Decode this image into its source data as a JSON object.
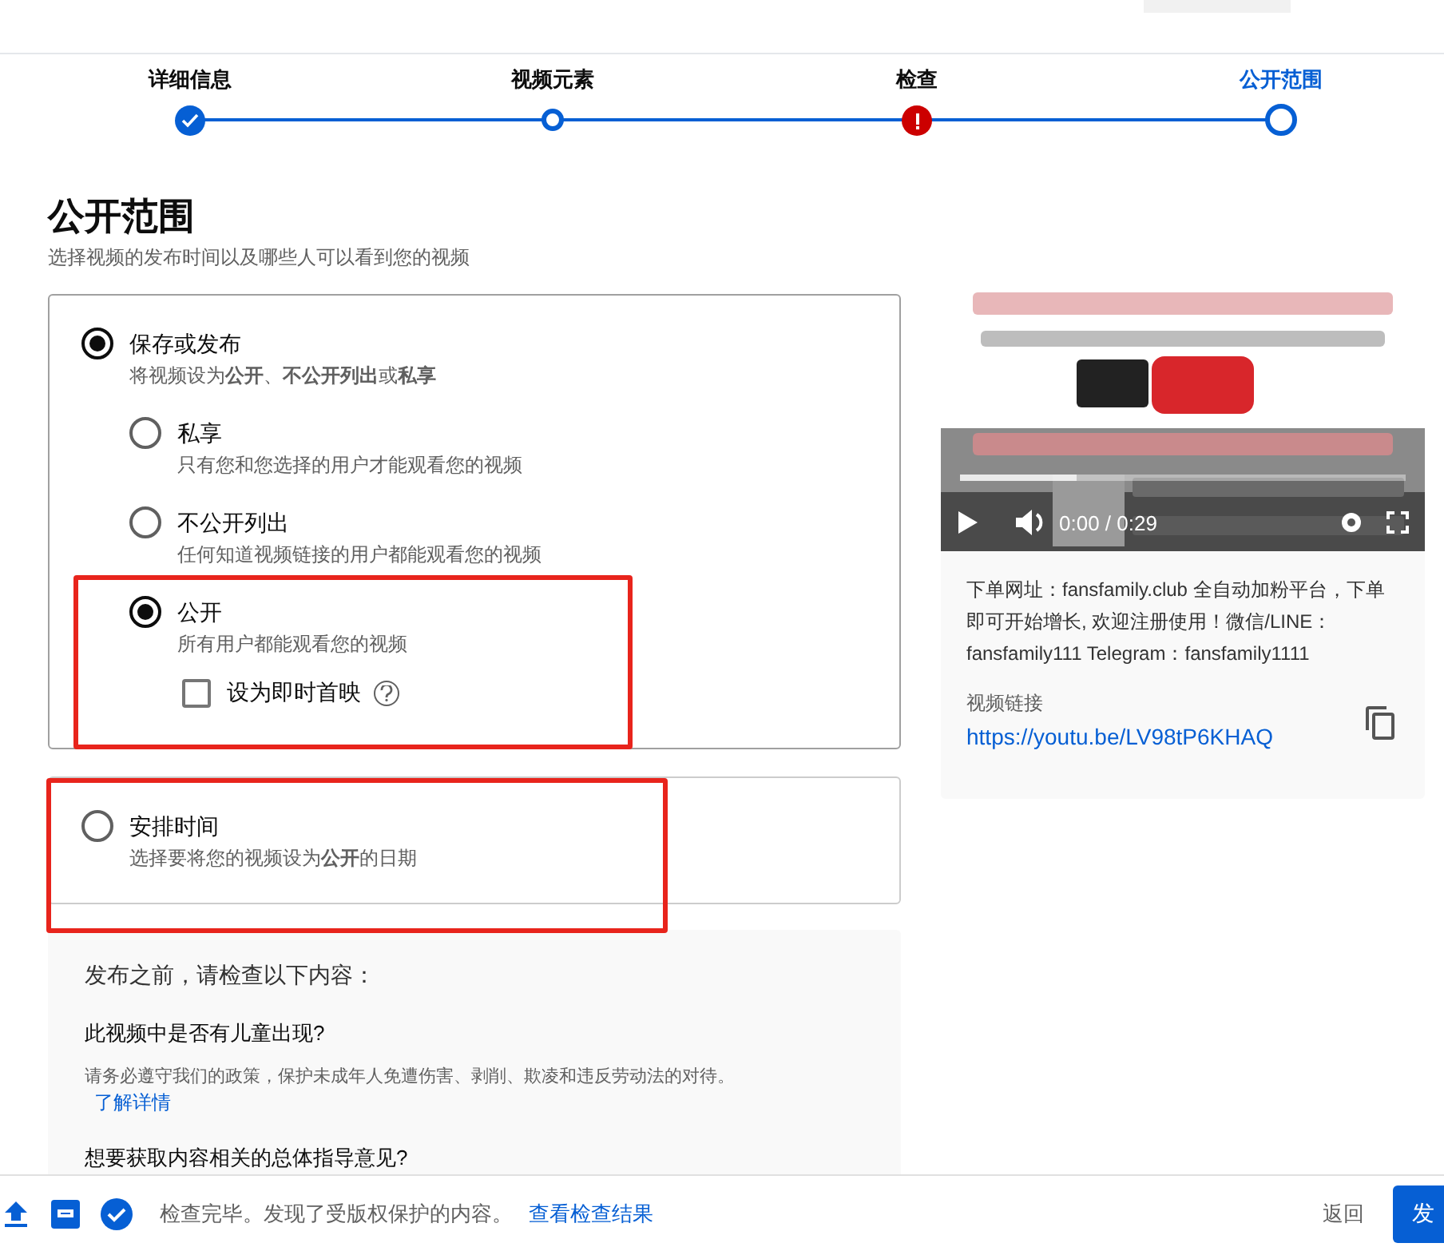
{
  "steps": [
    {
      "label": "详细信息",
      "kind": "done",
      "selected": false
    },
    {
      "label": "视频元素",
      "kind": "todo",
      "selected": false
    },
    {
      "label": "检查",
      "kind": "error",
      "selected": false
    },
    {
      "label": "公开范围",
      "kind": "todo",
      "selected": true
    }
  ],
  "heading": "公开范围",
  "subheading": "选择视频的发布时间以及哪些人可以看到您的视频",
  "save_option": {
    "label": "保存或发布",
    "description": "将视频设为**公开**、**不公开列出**或**私享**",
    "selected": true,
    "options": [
      {
        "label": "私享",
        "description": "只有您和您选择的用户才能观看您的视频",
        "selected": false
      },
      {
        "label": "不公开列出",
        "description": "任何知道视频链接的用户都能观看您的视频",
        "selected": false
      },
      {
        "label": "公开",
        "description": "所有用户都能观看您的视频",
        "selected": true
      }
    ],
    "premiere": {
      "label": "设为即时首映",
      "checked": false
    }
  },
  "schedule_option": {
    "label": "安排时间",
    "description": "选择要将您的视频设为**公开**的日期",
    "selected": false
  },
  "checklist": {
    "title": "发布之前，请检查以下内容：",
    "items": [
      {
        "question": "此视频中是否有儿童出现?",
        "text": "请务必遵守我们的政策，保护未成年人免遭伤害、剥削、欺凌和违反劳动法的对待。",
        "link": "了解详情"
      },
      {
        "question": "想要获取内容相关的总体指导意见?"
      }
    ]
  },
  "player": {
    "time": "0:00 / 0:29",
    "level": 0.26
  },
  "video_info": {
    "description": "下单网址：fansfamily.club 全自动加粉平台，下单即可开始增长, 欢迎注册使用！微信/LINE：fansfamily111 Telegram：fansfamily1111",
    "link_label": "视频链接",
    "link": "https://youtu.be/LV98tP6KHAQ"
  },
  "footer": {
    "status": "检查完毕。发现了受版权保护的内容。",
    "link": "查看检查结果",
    "back": "返回",
    "publish": "发"
  }
}
